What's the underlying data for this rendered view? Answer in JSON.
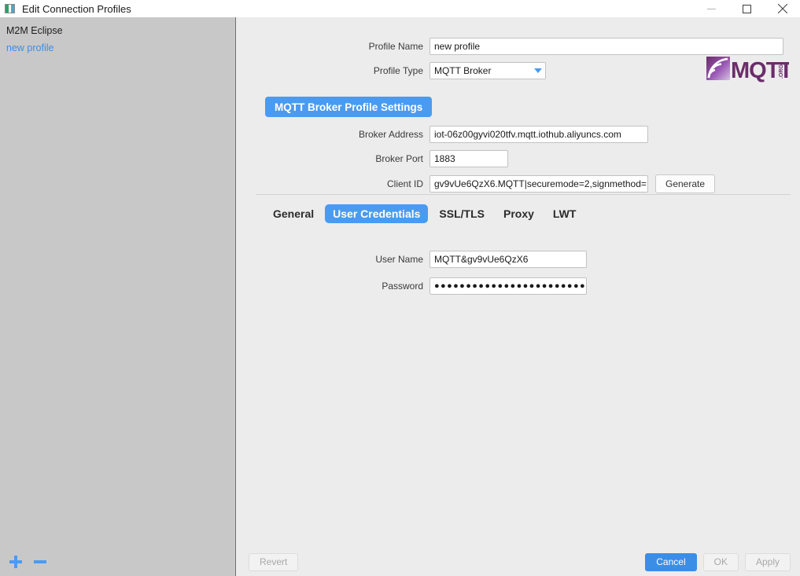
{
  "window": {
    "title": "Edit Connection Profiles",
    "icon": "app-window-icon",
    "controls": {
      "minimize": "minimize-icon",
      "maximize": "maximize-icon",
      "close": "close-icon"
    }
  },
  "sidebar": {
    "items": [
      {
        "label": "M2M Eclipse",
        "type": "root"
      },
      {
        "label": "new profile",
        "type": "link"
      }
    ],
    "footer": {
      "add_label": "+",
      "remove_label": "−"
    }
  },
  "form": {
    "profile_name": {
      "label": "Profile Name",
      "value": "new profile",
      "placeholder": ""
    },
    "profile_type": {
      "label": "Profile Type",
      "value": "MQTT Broker",
      "options": [
        "MQTT Broker"
      ]
    }
  },
  "logo": {
    "text": "MQTT",
    "suffix": ".ORG"
  },
  "section": {
    "title": "MQTT Broker Profile Settings",
    "broker_address": {
      "label": "Broker Address",
      "value": "iot-06z00gyvi020tfv.mqtt.iothub.aliyuncs.com"
    },
    "broker_port": {
      "label": "Broker Port",
      "value": "1883"
    },
    "client_id": {
      "label": "Client ID",
      "value": "gv9vUe6QzX6.MQTT|securemode=2,signmethod=",
      "generate_label": "Generate"
    }
  },
  "tabs": [
    {
      "label": "General",
      "active": false
    },
    {
      "label": "User Credentials",
      "active": true
    },
    {
      "label": "SSL/TLS",
      "active": false
    },
    {
      "label": "Proxy",
      "active": false
    },
    {
      "label": "LWT",
      "active": false
    }
  ],
  "credentials": {
    "user_name": {
      "label": "User Name",
      "value": "MQTT&gv9vUe6QzX6"
    },
    "password": {
      "label": "Password",
      "value": "●●●●●●●●●●●●●●●●●●●●●●●●●●●●"
    }
  },
  "footer": {
    "revert": "Revert",
    "cancel": "Cancel",
    "ok": "OK",
    "apply": "Apply"
  },
  "colors": {
    "accent": "#4a9bf0",
    "primary_button": "#3a8ee6",
    "sidebar": "#c8c8c8",
    "content": "#ececec",
    "link": "#3a8ee6"
  }
}
